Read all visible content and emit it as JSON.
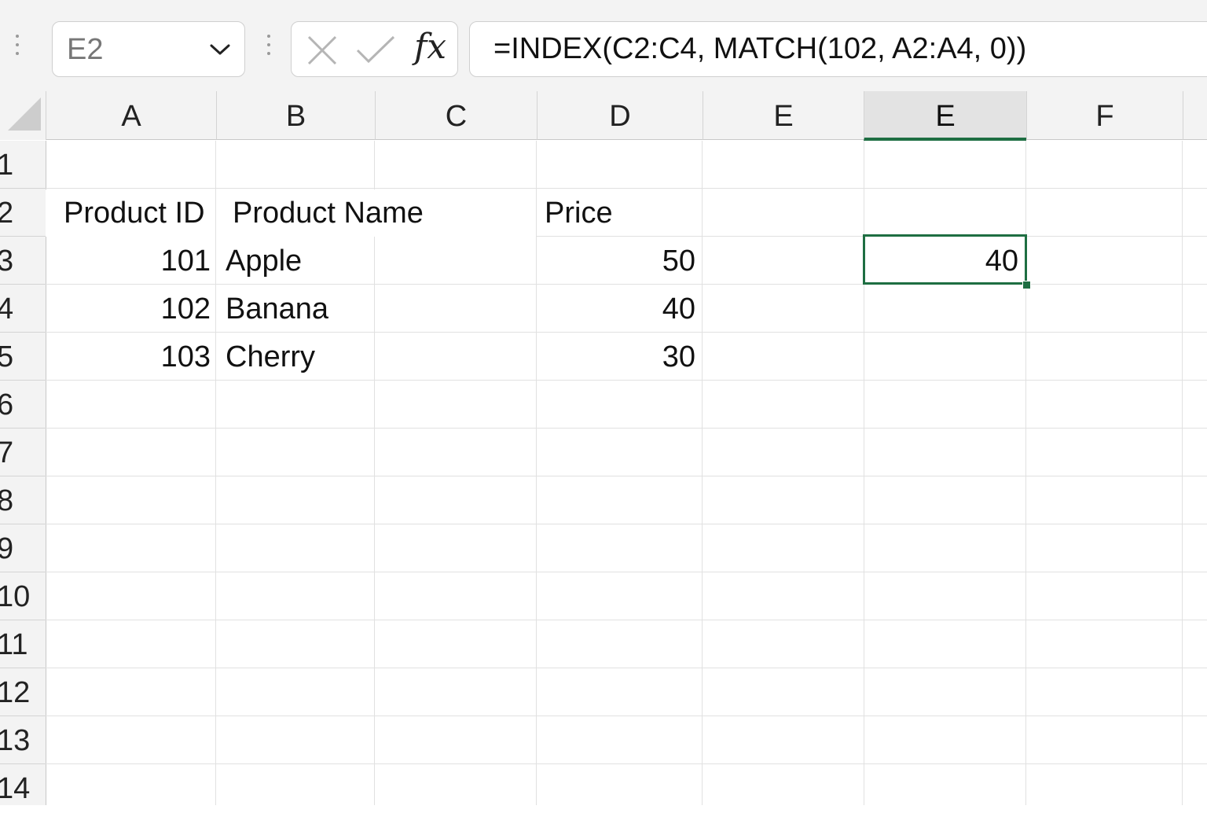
{
  "name_box": {
    "value": "E2"
  },
  "formula_bar": {
    "formula": "=INDEX(C2:C4, MATCH(102, A2:A4, 0))",
    "fx_label": "fx"
  },
  "columns": [
    "A",
    "B",
    "C",
    "D",
    "E",
    "E",
    "F"
  ],
  "rows": [
    "1",
    "2",
    "3",
    "4",
    "5",
    "6",
    "7",
    "8",
    "9",
    "10",
    "11",
    "12",
    "13",
    "14"
  ],
  "cells": {
    "header_product_id": "Product ID",
    "header_product_name": "Product Name",
    "header_price": "Price",
    "id_1": "101",
    "name_1": "Apple",
    "price_1": "50",
    "id_2": "102",
    "name_2": "Banana",
    "price_2": "40",
    "id_3": "103",
    "name_3": "Cherry",
    "price_3": "30"
  },
  "active_cell": {
    "value": "40"
  },
  "colors": {
    "accent": "#1e6e42",
    "header_bg": "#f3f3f3",
    "active_header_bg": "#e3e3e3"
  }
}
